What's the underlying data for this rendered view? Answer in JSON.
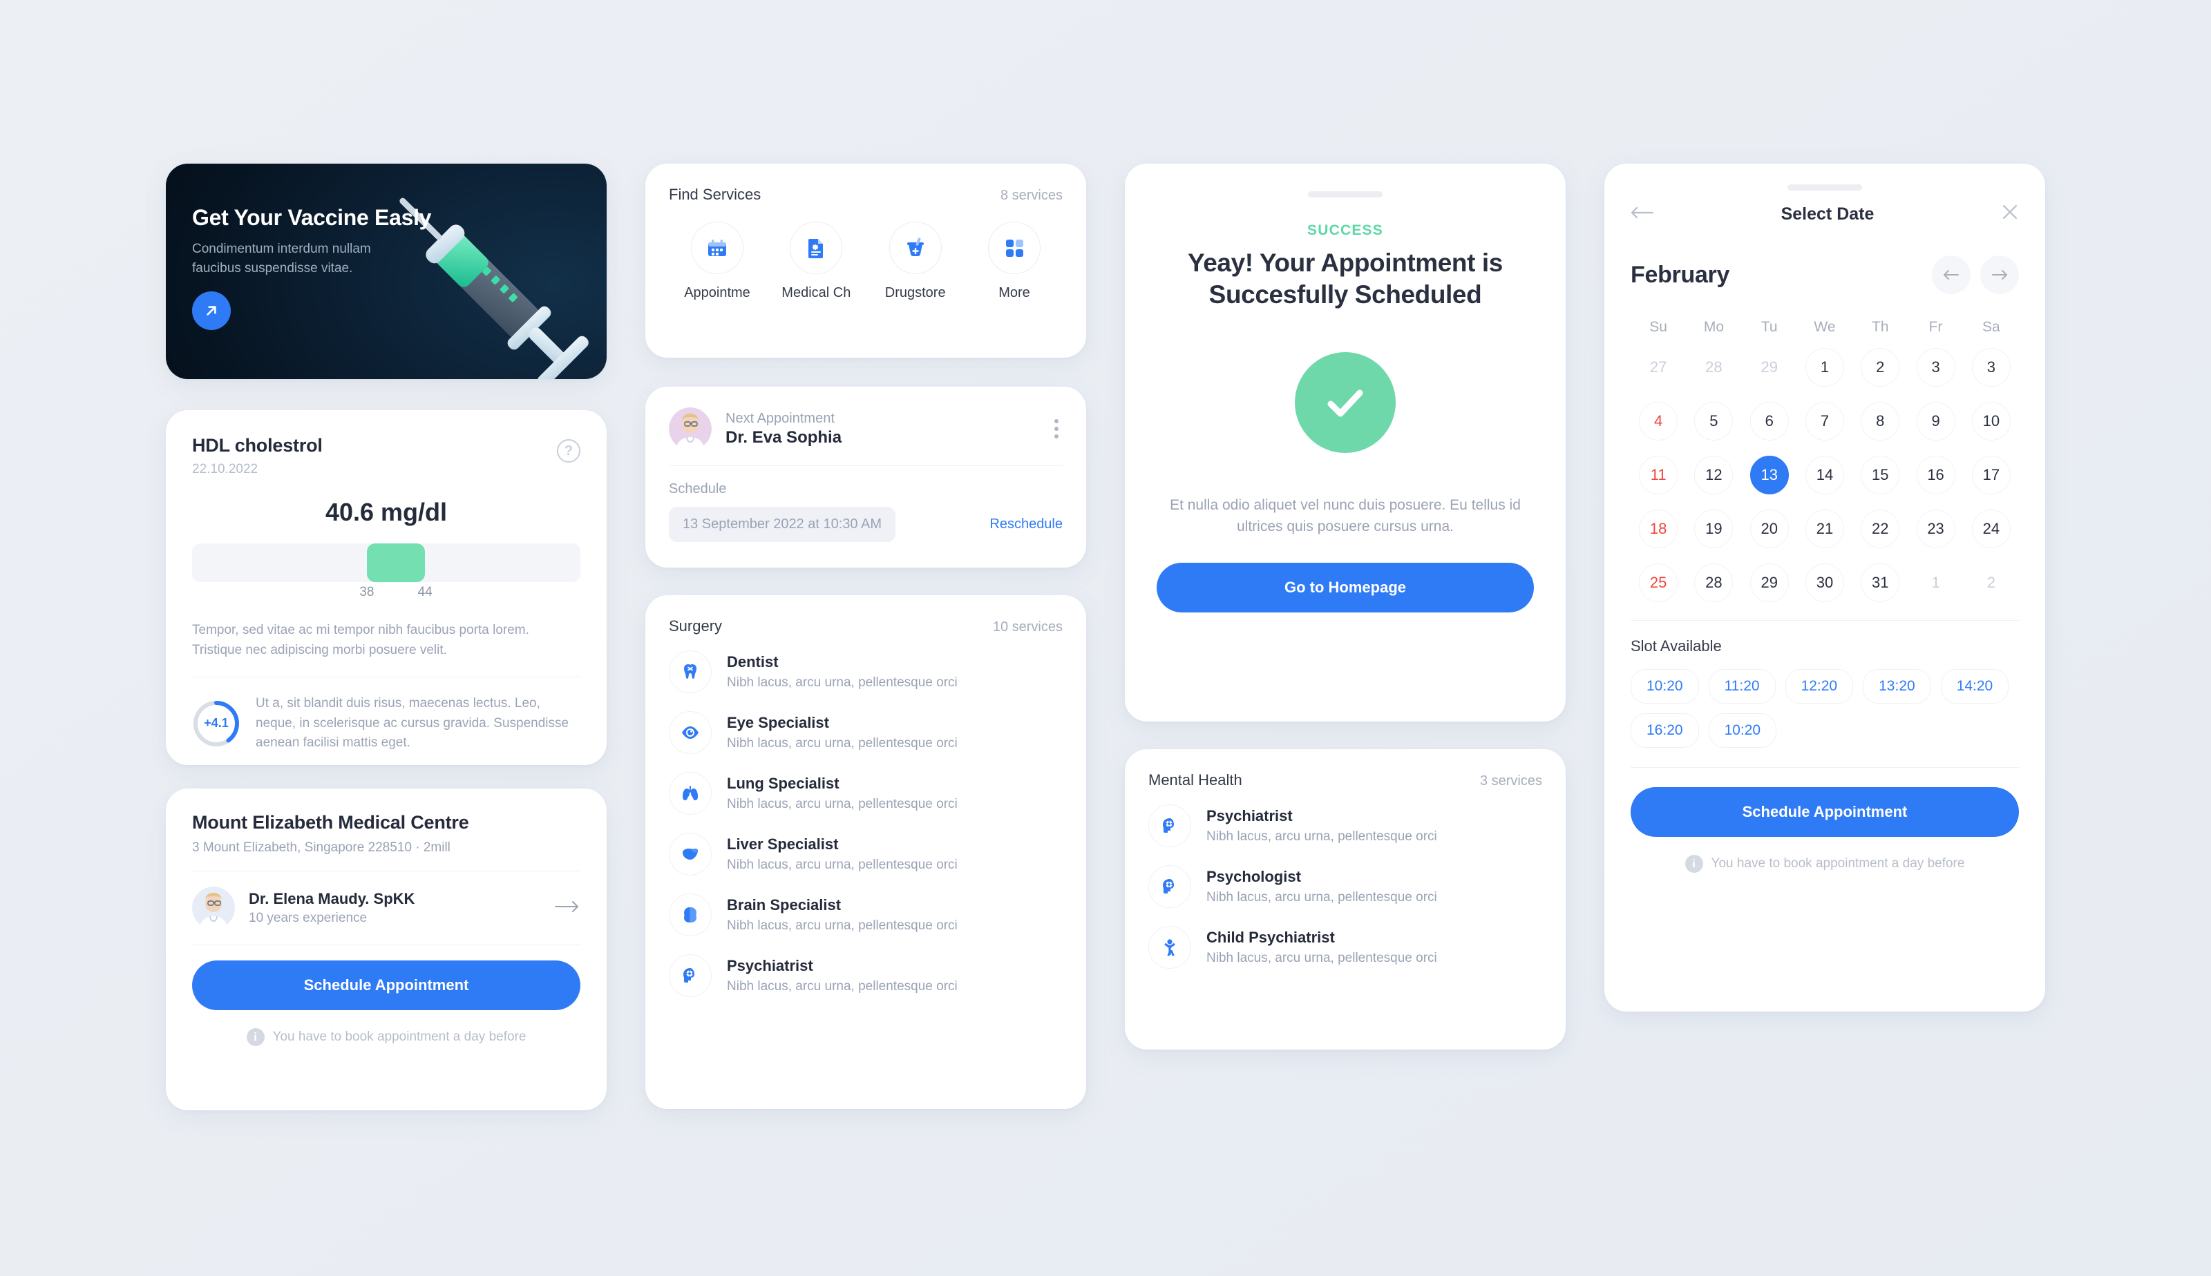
{
  "vaccine_banner": {
    "title": "Get Your Vaccine Easly",
    "subtitle": "Condimentum interdum nullam faucibus suspendisse vitae.",
    "cta_icon": "arrow-up-right-icon",
    "accent": "#2f7bf6",
    "illustration": "syringe-illustration"
  },
  "hdl": {
    "title": "HDL cholestrol",
    "date": "22.10.2022",
    "help_icon": "question-mark-icon",
    "value": "40.6 mg/dl",
    "range_low": "38",
    "range_high": "44",
    "bar_fill_color": "#74e0b2",
    "description": "Tempor, sed vitae ac mi tempor nibh faucibus porta lorem. Tristique nec adipiscing morbi posuere velit.",
    "delta": "+4.1",
    "delta_note": "Ut a, sit blandit duis risus, maecenas lectus. Leo, neque, in scelerisque ac cursus gravida. Suspendisse aenean facilisi mattis eget."
  },
  "clinic": {
    "name": "Mount Elizabeth Medical Centre",
    "address": "3 Mount Elizabeth, Singapore 228510  ·  2mill",
    "doctor_name": "Dr. Elena Maudy. SpKK",
    "doctor_experience": "10 years experience",
    "arrow_icon": "arrow-right-icon",
    "cta": "Schedule Appointment",
    "note": "You have to book appointment a day before",
    "note_icon": "info-icon"
  },
  "services": {
    "heading": "Find Services",
    "count": "8 services",
    "items": [
      {
        "label": "Appointme",
        "icon": "calendar-icon"
      },
      {
        "label": "Medical Ch",
        "icon": "document-medical-icon"
      },
      {
        "label": "Drugstore",
        "icon": "mortar-pestle-icon"
      },
      {
        "label": "More",
        "icon": "grid-squares-icon"
      }
    ]
  },
  "next_appointment": {
    "label": "Next Appointment",
    "doctor": "Dr. Eva Sophia",
    "menu_icon": "kebab-menu-icon",
    "schedule_label": "Schedule",
    "schedule_value": "13 September 2022 at 10:30 AM",
    "reschedule": "Reschedule"
  },
  "surgery": {
    "heading": "Surgery",
    "count": "10 services",
    "items": [
      {
        "title": "Dentist",
        "sub": "Nibh lacus, arcu urna, pellentesque orci",
        "icon": "tooth-icon"
      },
      {
        "title": "Eye Specialist",
        "sub": "Nibh lacus, arcu urna, pellentesque orci",
        "icon": "eye-icon"
      },
      {
        "title": "Lung Specialist",
        "sub": "Nibh lacus, arcu urna, pellentesque orci",
        "icon": "lungs-icon"
      },
      {
        "title": "Liver Specialist",
        "sub": "Nibh lacus, arcu urna, pellentesque orci",
        "icon": "liver-icon"
      },
      {
        "title": "Brain Specialist",
        "sub": "Nibh lacus, arcu urna, pellentesque orci",
        "icon": "brain-icon"
      },
      {
        "title": "Psychiatrist",
        "sub": "Nibh lacus, arcu urna, pellentesque orci",
        "icon": "head-gear-icon"
      }
    ]
  },
  "success": {
    "tag": "SUCCESS",
    "title": "Yeay! Your Appointment is Succesfully Scheduled",
    "check_icon": "check-circle-icon",
    "check_color": "#6ed8ab",
    "description": "Et nulla odio aliquet vel nunc duis posuere. Eu tellus id ultrices quis posuere cursus urna.",
    "cta": "Go to Homepage"
  },
  "mental_health": {
    "heading": "Mental Health",
    "count": "3 services",
    "items": [
      {
        "title": "Psychiatrist",
        "sub": "Nibh lacus, arcu urna, pellentesque orci",
        "icon": "head-gear-icon"
      },
      {
        "title": "Psychologist",
        "sub": "Nibh lacus, arcu urna, pellentesque orci",
        "icon": "head-gear-icon"
      },
      {
        "title": "Child Psychiatrist",
        "sub": "Nibh lacus, arcu urna, pellentesque orci",
        "icon": "child-icon"
      }
    ]
  },
  "calendar": {
    "back_icon": "arrow-left-icon",
    "title": "Select Date",
    "close_icon": "close-icon",
    "month": "February",
    "prev_icon": "arrow-left-icon",
    "next_icon": "arrow-right-icon",
    "weekdays": [
      "Su",
      "Mo",
      "Tu",
      "We",
      "Th",
      "Fr",
      "Sa"
    ],
    "weeks": [
      [
        {
          "d": "27",
          "state": "muted"
        },
        {
          "d": "28",
          "state": "muted"
        },
        {
          "d": "29",
          "state": "muted"
        },
        {
          "d": "1",
          "state": "normal"
        },
        {
          "d": "2",
          "state": "normal"
        },
        {
          "d": "3",
          "state": "normal"
        },
        {
          "d": "3",
          "state": "normal"
        }
      ],
      [
        {
          "d": "4",
          "state": "red"
        },
        {
          "d": "5",
          "state": "normal"
        },
        {
          "d": "6",
          "state": "normal"
        },
        {
          "d": "7",
          "state": "normal"
        },
        {
          "d": "8",
          "state": "normal"
        },
        {
          "d": "9",
          "state": "normal"
        },
        {
          "d": "10",
          "state": "normal"
        }
      ],
      [
        {
          "d": "11",
          "state": "red"
        },
        {
          "d": "12",
          "state": "normal"
        },
        {
          "d": "13",
          "state": "selected"
        },
        {
          "d": "14",
          "state": "normal"
        },
        {
          "d": "15",
          "state": "normal"
        },
        {
          "d": "16",
          "state": "normal"
        },
        {
          "d": "17",
          "state": "normal"
        }
      ],
      [
        {
          "d": "18",
          "state": "red"
        },
        {
          "d": "19",
          "state": "normal"
        },
        {
          "d": "20",
          "state": "normal"
        },
        {
          "d": "21",
          "state": "normal"
        },
        {
          "d": "22",
          "state": "normal"
        },
        {
          "d": "23",
          "state": "normal"
        },
        {
          "d": "24",
          "state": "normal"
        }
      ],
      [
        {
          "d": "25",
          "state": "red"
        },
        {
          "d": "28",
          "state": "normal"
        },
        {
          "d": "29",
          "state": "normal"
        },
        {
          "d": "30",
          "state": "normal"
        },
        {
          "d": "31",
          "state": "normal"
        },
        {
          "d": "1",
          "state": "muted"
        },
        {
          "d": "2",
          "state": "muted"
        }
      ]
    ],
    "slot_title": "Slot Available",
    "slots": [
      "10:20",
      "11:20",
      "12:20",
      "13:20",
      "14:20",
      "16:20",
      "10:20"
    ],
    "cta": "Schedule Appointment",
    "note": "You have to book appointment a day before",
    "note_icon": "info-icon",
    "selected_color": "#2f7bf6",
    "holiday_color": "#f2453d"
  }
}
